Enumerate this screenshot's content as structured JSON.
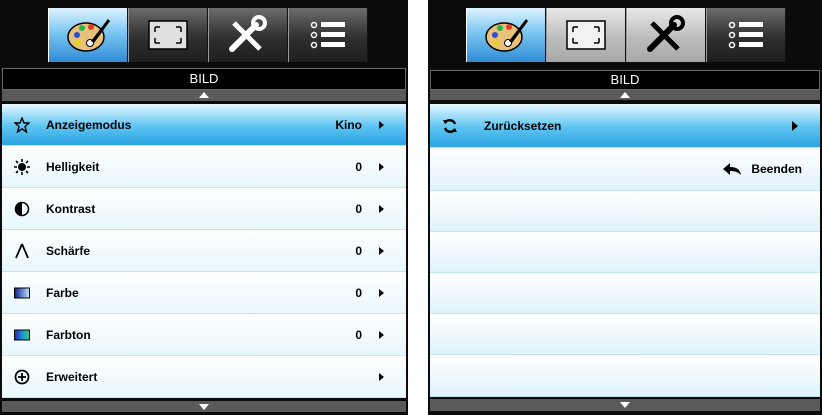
{
  "left_panel": {
    "tabs": [
      {
        "name": "picture-tab",
        "icon": "palette-icon"
      },
      {
        "name": "display-tab",
        "icon": "screen-frame-icon"
      },
      {
        "name": "setup-tab",
        "icon": "tools-icon"
      },
      {
        "name": "options-tab",
        "icon": "list-icon"
      }
    ],
    "title": "BILD",
    "items": [
      {
        "label": "Anzeigemodus",
        "value": "Kino",
        "icon": "star-icon",
        "selected": true
      },
      {
        "label": "Helligkeit",
        "value": "0",
        "icon": "brightness-icon"
      },
      {
        "label": "Kontrast",
        "value": "0",
        "icon": "contrast-icon"
      },
      {
        "label": "Schärfe",
        "value": "0",
        "icon": "sharpness-icon"
      },
      {
        "label": "Farbe",
        "value": "0",
        "icon": "color-icon"
      },
      {
        "label": "Farbton",
        "value": "0",
        "icon": "tint-icon"
      },
      {
        "label": "Erweitert",
        "value": "",
        "icon": "advanced-plus-icon"
      }
    ]
  },
  "right_panel": {
    "title": "BILD",
    "items": [
      {
        "label": "Zurücksetzen",
        "icon": "reset-icon",
        "selected": true
      }
    ],
    "exit_label": "Beenden",
    "exit_icon": "return-arrow-icon"
  },
  "colors": {
    "accent": "#2aa3e2",
    "row_bg": "#e7f7fc",
    "frame": "#0b0b0b"
  }
}
